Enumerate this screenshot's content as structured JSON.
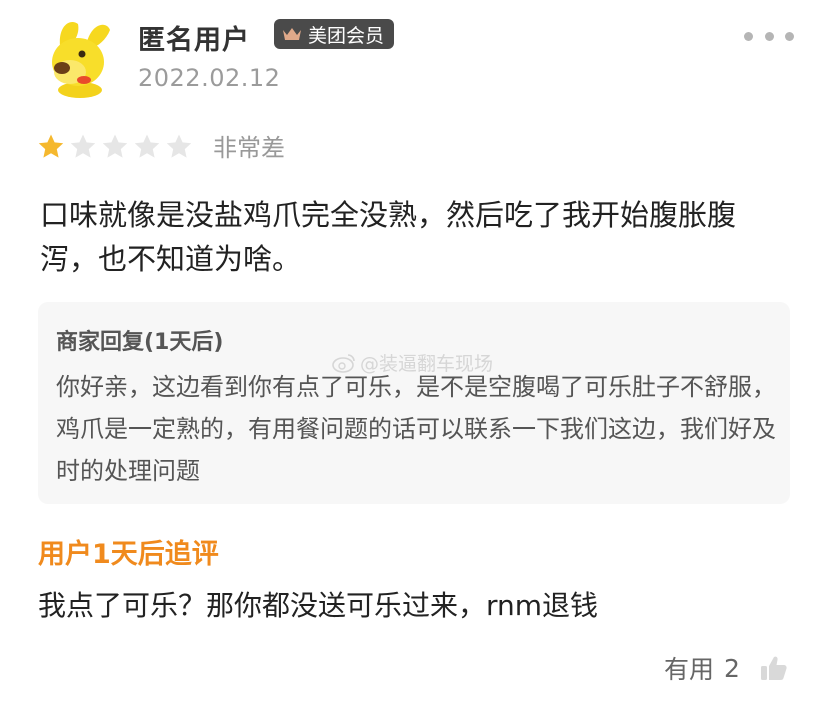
{
  "review": {
    "username": "匿名用户",
    "member_badge": "美团会员",
    "date": "2022.02.12",
    "rating": 1,
    "rating_max": 5,
    "rating_text": "非常差",
    "text": "口味就像是没盐鸡爪完全没熟，然后吃了我开始腹胀腹泻，也不知道为啥。"
  },
  "merchant_reply": {
    "title": "商家回复(1天后)",
    "text": "你好亲，这边看到你有点了可乐，是不是空腹喝了可乐肚子不舒服，鸡爪是一定熟的，有用餐问题的话可以联系一下我们这边，我们好及时的处理问题"
  },
  "watermark": {
    "text": "@装逼翻车现场"
  },
  "followup": {
    "title": "用户1天后追评",
    "text": "我点了可乐？那你都没送可乐过来，rnm退钱"
  },
  "helpful": {
    "label": "有用",
    "count": "2"
  },
  "colors": {
    "star_filled": "#f5b82e",
    "star_empty": "#e6e6e6",
    "followup_accent": "#f08a1d",
    "badge_bg": "#4a4a4a"
  }
}
